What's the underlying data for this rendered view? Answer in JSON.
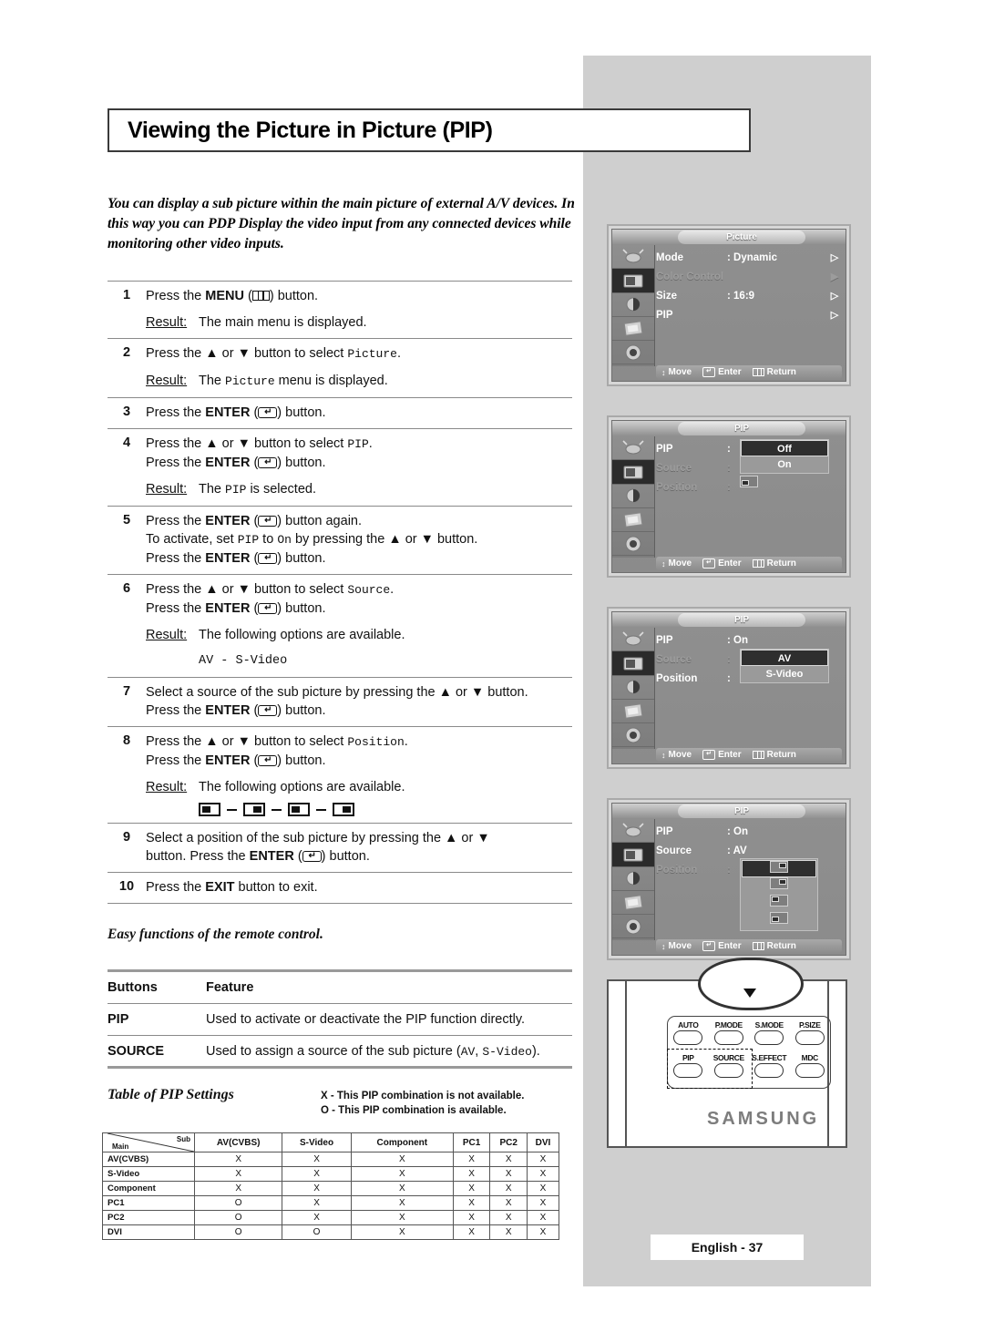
{
  "page": {
    "title": "Viewing the Picture in Picture (PIP)",
    "intro": "You can display a sub picture within the main picture of external A/V devices. In this way you can PDP Display the video input from any connected devices while monitoring other video inputs.",
    "footer": "English - 37"
  },
  "steps": [
    {
      "num": "1",
      "lines": [
        "Press the MENU (▭) button."
      ],
      "result_label": "Result:",
      "result_text": "The main menu is displayed."
    },
    {
      "num": "2",
      "lines": [
        "Press the ▲ or ▼ button to select Picture."
      ],
      "result_label": "Result:",
      "result_text": "The Picture menu is displayed."
    },
    {
      "num": "3",
      "lines": [
        "Press the ENTER (↵) button."
      ]
    },
    {
      "num": "4",
      "lines": [
        "Press the ▲ or ▼ button to select PIP.",
        "Press the ENTER (↵) button."
      ],
      "result_label": "Result:",
      "result_text": "The PIP is selected."
    },
    {
      "num": "5",
      "lines": [
        "Press the ENTER (↵) button again.",
        "To activate, set PIP to On by pressing the ▲ or ▼ button.",
        "Press the ENTER (↵) button."
      ]
    },
    {
      "num": "6",
      "lines": [
        "Press the ▲ or ▼ button to select Source.",
        "Press the ENTER (↵) button."
      ],
      "result_label": "Result:",
      "result_text": "The following options are available.",
      "options_text": "AV - S-Video"
    },
    {
      "num": "7",
      "lines": [
        "Select a source of the sub picture by pressing the ▲ or ▼ button.",
        "Press the ENTER (↵) button."
      ]
    },
    {
      "num": "8",
      "lines": [
        "Press the ▲ or ▼ button to select Position.",
        "Press the ENTER (↵) button."
      ],
      "result_label": "Result:",
      "result_text": "The following options are available.",
      "position_icons": [
        "bottom-left",
        "top-right",
        "top-left",
        "bottom-right"
      ]
    },
    {
      "num": "9",
      "lines": [
        "Select a position of the sub picture by pressing the ▲ or ▼",
        "button. Press the ENTER (↵) button."
      ]
    },
    {
      "num": "10",
      "lines": [
        "Press the EXIT button to exit."
      ]
    }
  ],
  "easy_functions": {
    "heading": "Easy functions of the remote control.",
    "columns": [
      "Buttons",
      "Feature"
    ],
    "rows": [
      {
        "button": "PIP",
        "feature": "Used to activate or deactivate the PIP function directly."
      },
      {
        "button": "SOURCE",
        "feature": "Used to assign a source of the sub picture (AV, S-Video)."
      }
    ]
  },
  "pip_settings": {
    "title": "Table of PIP Settings",
    "legend": [
      "X - This PIP combination is not available.",
      "O - This PIP combination is available."
    ],
    "corner": {
      "main": "Main",
      "sub": "Sub"
    },
    "columns": [
      "AV(CVBS)",
      "S-Video",
      "Component",
      "PC1",
      "PC2",
      "DVI"
    ],
    "rows": [
      {
        "label": "AV(CVBS)",
        "cells": [
          "X",
          "X",
          "X",
          "X",
          "X",
          "X"
        ]
      },
      {
        "label": "S-Video",
        "cells": [
          "X",
          "X",
          "X",
          "X",
          "X",
          "X"
        ]
      },
      {
        "label": "Component",
        "cells": [
          "X",
          "X",
          "X",
          "X",
          "X",
          "X"
        ]
      },
      {
        "label": "PC1",
        "cells": [
          "O",
          "X",
          "X",
          "X",
          "X",
          "X"
        ]
      },
      {
        "label": "PC2",
        "cells": [
          "O",
          "X",
          "X",
          "X",
          "X",
          "X"
        ]
      },
      {
        "label": "DVI",
        "cells": [
          "O",
          "O",
          "X",
          "X",
          "X",
          "X"
        ]
      }
    ]
  },
  "osd_screens": [
    {
      "tab": "Picture",
      "rows": [
        {
          "label": "Mode",
          "value": ": Dynamic",
          "arrow": "▷",
          "dim": false
        },
        {
          "label": "Color Control",
          "value": "",
          "arrow": "▶",
          "dim": true
        },
        {
          "label": "Size",
          "value": ": 16:9",
          "arrow": "▷",
          "dim": false
        },
        {
          "label": "PIP",
          "value": "",
          "arrow": "▷",
          "dim": false
        }
      ],
      "footer": {
        "move": "Move",
        "enter": "Enter",
        "return": "Return"
      }
    },
    {
      "tab": "PIP",
      "rows": [
        {
          "label": "PIP",
          "value": ":",
          "arrow": "",
          "dim": false
        },
        {
          "label": "Source",
          "value": ":",
          "arrow": "",
          "dim": true
        },
        {
          "label": "Position",
          "value": ":",
          "arrow": "",
          "dim": true
        }
      ],
      "dropdown": {
        "items": [
          "Off",
          "On"
        ],
        "selected": "Off"
      },
      "footer": {
        "move": "Move",
        "enter": "Enter",
        "return": "Return"
      }
    },
    {
      "tab": "PIP",
      "rows": [
        {
          "label": "PIP",
          "value": ": On",
          "arrow": "",
          "dim": false
        },
        {
          "label": "Source",
          "value": ":",
          "arrow": "",
          "dim": true
        },
        {
          "label": "Position",
          "value": ":",
          "arrow": "",
          "dim": false
        }
      ],
      "dropdown": {
        "items": [
          "AV",
          "S-Video"
        ],
        "selected": "AV"
      },
      "footer": {
        "move": "Move",
        "enter": "Enter",
        "return": "Return"
      }
    },
    {
      "tab": "PIP",
      "rows": [
        {
          "label": "PIP",
          "value": ": On",
          "arrow": "",
          "dim": false
        },
        {
          "label": "Source",
          "value": ": AV",
          "arrow": "",
          "dim": false
        },
        {
          "label": "Position",
          "value": ":",
          "arrow": "",
          "dim": true
        }
      ],
      "position_dropdown": [
        "top-right",
        "top-right",
        "top-left",
        "bottom-left"
      ],
      "footer": {
        "move": "Move",
        "enter": "Enter",
        "return": "Return"
      }
    }
  ],
  "remote": {
    "brand": "SAMSUNG",
    "buttons_row1": [
      "AUTO",
      "P.MODE",
      "S.MODE",
      "P.SIZE"
    ],
    "buttons_row2": [
      "PIP",
      "SOURCE",
      "S.EFFECT",
      "MDC"
    ],
    "highlighted": [
      "PIP",
      "SOURCE"
    ]
  }
}
